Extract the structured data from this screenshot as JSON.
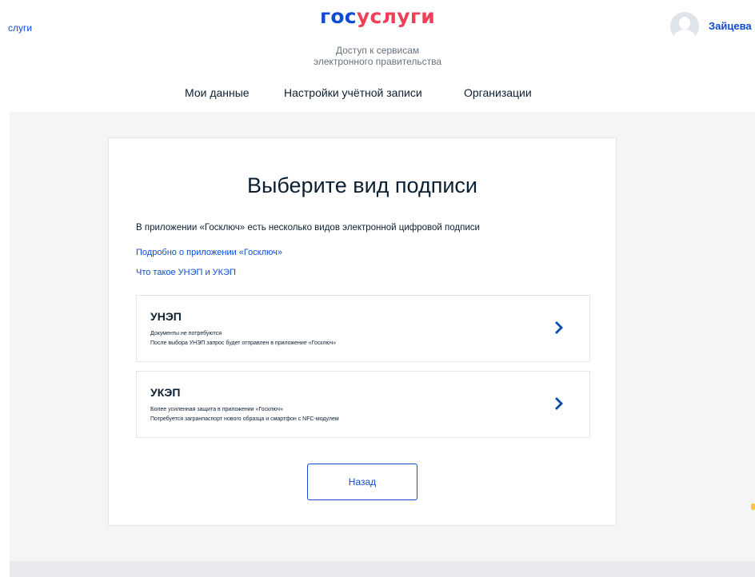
{
  "header": {
    "left_link": "слуги",
    "logo_part1": "гос",
    "logo_part2": "услуги",
    "subtitle_line1": "Доступ к сервисам",
    "subtitle_line2": "электронного правительства",
    "user_name": "Зайцева",
    "avatar_icon": "user-avatar-icon"
  },
  "tabs": [
    {
      "label": "Мои данные",
      "active": false
    },
    {
      "label": "Настройки учётной записи",
      "active": false
    },
    {
      "label": "Организации",
      "active": true
    }
  ],
  "card": {
    "title": "Выберите вид подписи",
    "description": "В приложении «Госключ» есть несколько видов электронной цифровой подписи",
    "link_about": "Подробно о приложении «Госключ»",
    "link_what": "Что такое УНЭП и УКЭП",
    "options": [
      {
        "title": "УНЭП",
        "line1": "Документы не потребуются",
        "line2": "После выбора УНЭП запрос будет отправлен в приложение «Госключ»",
        "icon": "chevron-right-icon"
      },
      {
        "title": "УКЭП",
        "line1": "Более усиленная защита в приложении «Госключ»",
        "line2": "Потребуется загранпаспорт нового образца и смартфон с NFC-модулем",
        "icon": "chevron-right-icon"
      }
    ],
    "back_label": "Назад"
  },
  "colors": {
    "brand_blue": "#0d4cd3",
    "brand_red": "#ee3f58",
    "text": "#0b1f33",
    "background_gray": "#f5f5f5"
  }
}
